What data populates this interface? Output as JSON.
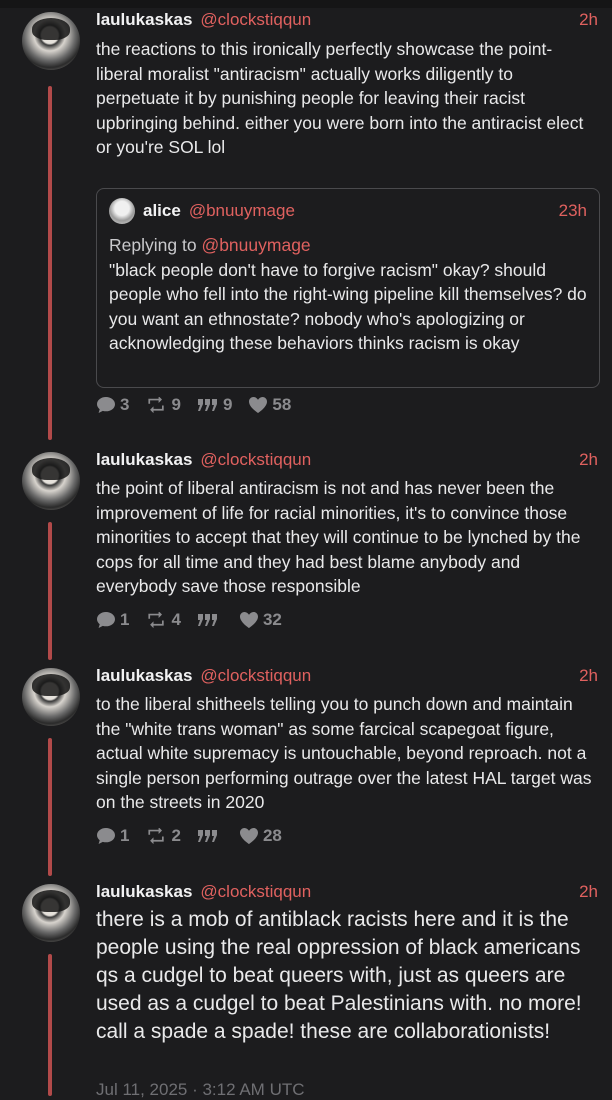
{
  "posts": [
    {
      "username": "laulukaskas",
      "handle": "@clockstiqqun",
      "time": "2h",
      "text": "the reactions to this ironically perfectly showcase the point- liberal moralist \"antiracism\" actually works diligently to perpetuate it by punishing people for leaving their racist upbringing behind. either you were born into the antiracist elect or you're SOL lol",
      "quote": {
        "username": "alice",
        "handle": "@bnuuymage",
        "time": "23h",
        "replying_label": "Replying to",
        "replying_handle": "@bnuuymage",
        "text": "\"black people don't have to forgive racism\" okay? should people who fell into the right-wing pipeline kill themselves? do you want an ethnostate? nobody who's apologizing or acknowledging these behaviors thinks racism is okay"
      },
      "stats": {
        "replies": "3",
        "reposts": "9",
        "quotes": "9",
        "likes": "58"
      }
    },
    {
      "username": "laulukaskas",
      "handle": "@clockstiqqun",
      "time": "2h",
      "text": "the point of liberal antiracism is not and has never been the improvement of life for racial minorities, it's to convince those minorities to accept that they will continue to be lynched by the cops for all time and they had best blame anybody and everybody save those responsible",
      "stats": {
        "replies": "1",
        "reposts": "4",
        "quotes": "",
        "likes": "32"
      }
    },
    {
      "username": "laulukaskas",
      "handle": "@clockstiqqun",
      "time": "2h",
      "text": "to the liberal shitheels telling you to punch down and maintain the \"white trans woman\" as some farcical scapegoat figure, actual white supremacy is untouchable, beyond reproach. not a single person performing outrage over the latest HAL target was on the streets in 2020",
      "stats": {
        "replies": "1",
        "reposts": "2",
        "quotes": "",
        "likes": "28"
      }
    },
    {
      "username": "laulukaskas",
      "handle": "@clockstiqqun",
      "time": "2h",
      "text": "there is a mob of antiblack racists here and it is the people using the real oppression of black americans qs a cudgel to beat queers with, just as queers are used as a cudgel to beat Palestinians with. no more! call a spade a spade! these are collaborationists!",
      "date": "Jul 11, 2025 · 3:12 AM UTC"
    }
  ],
  "colors": {
    "accent": "#e0615f",
    "thread": "#b24a4a",
    "background": "#1c1c1e"
  },
  "icons": [
    "reply-icon",
    "repost-icon",
    "quote-icon",
    "like-icon"
  ]
}
